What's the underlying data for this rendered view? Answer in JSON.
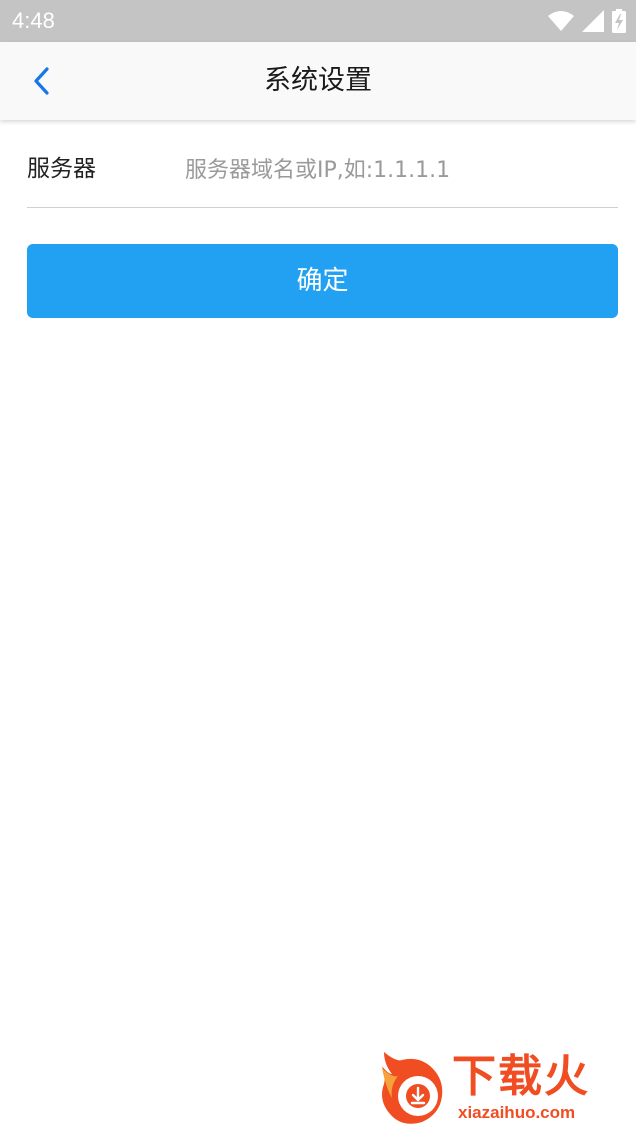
{
  "status_bar": {
    "time": "4:48",
    "icons": [
      "wifi-icon",
      "signal-icon",
      "battery-charging-icon"
    ]
  },
  "toolbar": {
    "title": "系统设置",
    "back_icon": "chevron-left-icon"
  },
  "form": {
    "server_label": "服务器",
    "server_value": "",
    "server_placeholder": "服务器域名或IP,如:1.1.1.1"
  },
  "confirm_label": "确定",
  "watermark": {
    "brand": "下载火",
    "url": "xiazaihuo.com"
  },
  "colors": {
    "status_bar": "#c4c4c4",
    "toolbar_bg": "#f9f9f9",
    "accent_blue": "#22a0f2",
    "back_icon": "#1677e6",
    "watermark": "#f04d23"
  }
}
